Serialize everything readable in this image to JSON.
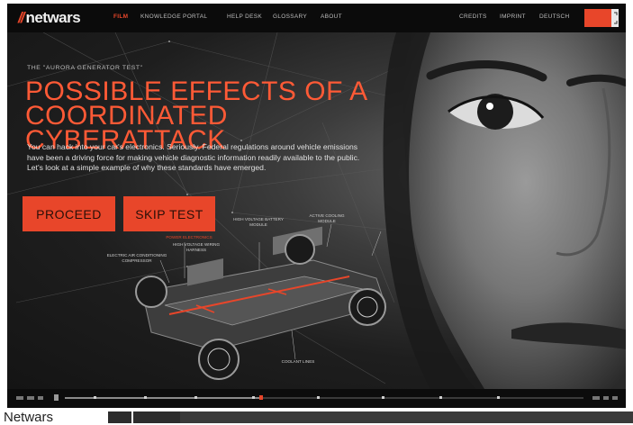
{
  "site": {
    "logo_mark": "//",
    "logo_text": "netwars"
  },
  "nav": {
    "items": [
      {
        "label": "FILM",
        "active": true
      },
      {
        "label": "KNOWLEDGE PORTAL"
      },
      {
        "label": "HELP DESK"
      },
      {
        "label": "GLOSSARY"
      },
      {
        "label": "ABOUT"
      },
      {
        "label": "CREDITS"
      },
      {
        "label": "IMPRINT"
      },
      {
        "label": "DEUTSCH"
      }
    ]
  },
  "hero": {
    "tag": "THE \"AURORA GENERATOR TEST\"",
    "headline": "POSSIBLE EFFECTS OF A COORDINATED CYBERATTACK",
    "body": "You can hack into your car's electronics. Seriously. Federal regulations around vehicle emissions have been a driving force for making vehicle diagnostic information readily available to the public. Let's look at a simple example of why these standards have emerged."
  },
  "buttons": {
    "proceed": "PROCEED",
    "skip": "SKIP TEST"
  },
  "car_labels": {
    "power_electronics": "POWER ELECTRONICS",
    "battery": "HIGH VOLTAGE BATTERY MODULE",
    "cooling": "ACTIVE COOLING MODULE",
    "wiring": "HIGH VOLTAGE WIRING HARNESS",
    "compressor": "ELECTRIC AIR CONDITIONING COMPRESSOR",
    "coolant": "COOLANT LINES"
  },
  "caption": "Netwars",
  "colors": {
    "accent": "#e8462a",
    "headline": "#ff5a36",
    "background": "#141414"
  }
}
